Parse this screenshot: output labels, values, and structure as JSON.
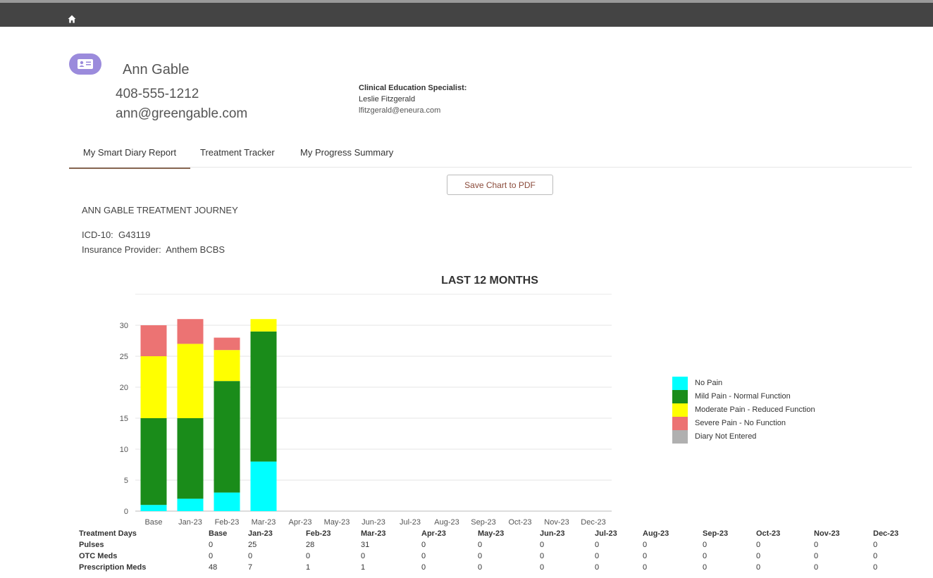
{
  "nav": {
    "home_icon": "home-icon"
  },
  "profile": {
    "avatar_icon": "contact-card-icon",
    "name": "Ann Gable",
    "phone": "408-555-1212",
    "email": "ann@greengable.com"
  },
  "specialist": {
    "label": "Clinical Education Specialist:",
    "name": "Leslie Fitzgerald",
    "email": "lfitzgerald@eneura.com"
  },
  "tabs": [
    {
      "label": "My Smart Diary Report",
      "active": true
    },
    {
      "label": "Treatment Tracker",
      "active": false
    },
    {
      "label": "My Progress Summary",
      "active": false
    }
  ],
  "save_button_label": "Save Chart to PDF",
  "report": {
    "title": "ANN GABLE TREATMENT JOURNEY",
    "icd": "ICD-10:  G43119",
    "insurance": "Insurance Provider:  Anthem BCBS"
  },
  "chart_data": {
    "type": "bar",
    "stacked": true,
    "title": "LAST 12 MONTHS",
    "categories": [
      "Base",
      "Jan-23",
      "Feb-23",
      "Mar-23",
      "Apr-23",
      "May-23",
      "Jun-23",
      "Jul-23",
      "Aug-23",
      "Sep-23",
      "Oct-23",
      "Nov-23",
      "Dec-23"
    ],
    "yticks": [
      "0",
      "5",
      "10",
      "15",
      "20",
      "25",
      "30"
    ],
    "ylim": [
      0,
      35
    ],
    "grid": true,
    "legend_position": "right",
    "series": [
      {
        "name": "No Pain",
        "color": "#00ffff",
        "values": [
          1,
          2,
          3,
          8,
          0,
          0,
          0,
          0,
          0,
          0,
          0,
          0,
          0
        ]
      },
      {
        "name": "Mild Pain - Normal Function",
        "color": "#1a8c1a",
        "values": [
          14,
          13,
          18,
          21,
          0,
          0,
          0,
          0,
          0,
          0,
          0,
          0,
          0
        ]
      },
      {
        "name": "Moderate Pain - Reduced Function",
        "color": "#ffff00",
        "values": [
          10,
          12,
          5,
          2,
          0,
          0,
          0,
          0,
          0,
          0,
          0,
          0,
          0
        ]
      },
      {
        "name": "Severe Pain - No Function",
        "color": "#ec7373",
        "values": [
          5,
          4,
          2,
          0,
          0,
          0,
          0,
          0,
          0,
          0,
          0,
          0,
          0
        ]
      },
      {
        "name": "Diary Not Entered",
        "color": "#b0b0b0",
        "values": [
          0,
          0,
          0,
          0,
          0,
          0,
          0,
          0,
          0,
          0,
          0,
          0,
          0
        ]
      }
    ]
  },
  "table": {
    "header_label": "Treatment Days",
    "columns": [
      "Base",
      "Jan-23",
      "Feb-23",
      "Mar-23",
      "Apr-23",
      "May-23",
      "Jun-23",
      "Jul-23",
      "Aug-23",
      "Sep-23",
      "Oct-23",
      "Nov-23",
      "Dec-23"
    ],
    "rows": [
      {
        "label": "Pulses",
        "values": [
          "0",
          "25",
          "28",
          "31",
          "0",
          "0",
          "0",
          "0",
          "0",
          "0",
          "0",
          "0",
          "0"
        ]
      },
      {
        "label": "OTC Meds",
        "values": [
          "0",
          "0",
          "0",
          "0",
          "0",
          "0",
          "0",
          "0",
          "0",
          "0",
          "0",
          "0",
          "0"
        ]
      },
      {
        "label": "Prescription Meds",
        "values": [
          "48",
          "7",
          "1",
          "1",
          "0",
          "0",
          "0",
          "0",
          "0",
          "0",
          "0",
          "0",
          "0"
        ]
      }
    ]
  }
}
